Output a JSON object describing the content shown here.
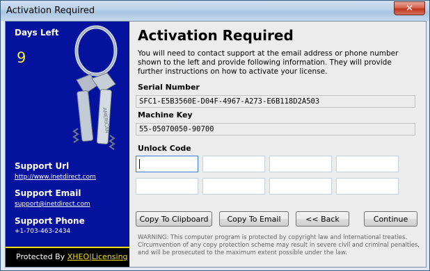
{
  "window": {
    "title": "Activation Required",
    "close_glyph": "✕"
  },
  "sidebar": {
    "days_left_label": "Days Left",
    "days_left_value": "9",
    "support_url_label": "Support Url",
    "support_url_value": "http://www.inetdirect.com",
    "support_email_label": "Support Email",
    "support_email_value": "support@inetdirect.com",
    "support_phone_label": "Support Phone",
    "support_phone_value": "+1-703-463-2434",
    "protected_prefix": "Protected By ",
    "protected_link": "XHEO|Licensing",
    "key_engraving": "AMERICAN",
    "background_color": "#04129e",
    "accent_color": "#f2e000",
    "days_color": "#f1ef28"
  },
  "main": {
    "heading": "Activation Required",
    "description": "You will need to contact support at the email address or phone number shown to the left and provide following information. They will provide further instructions on how to activate your license.",
    "serial_label": "Serial Number",
    "serial_value": "SFC1-E5B3560E-D04F-4967-A273-E6B118D2A503",
    "machine_label": "Machine Key",
    "machine_value": "55-05070050-90700",
    "unlock_label": "Unlock Code",
    "unlock_boxes": [
      "",
      "",
      "",
      "",
      "",
      "",
      "",
      ""
    ],
    "buttons": {
      "clipboard": "Copy To Clipboard",
      "email": "Copy To Email",
      "back": "<< Back",
      "continue": "Continue"
    },
    "warning": "WARNING: This computer program is protected by copyright law and international treaties. Circumvention of any copy protection scheme may result in severe civil and criminal penalties, and will be prosecuted to the maximum extent possible under the law."
  }
}
